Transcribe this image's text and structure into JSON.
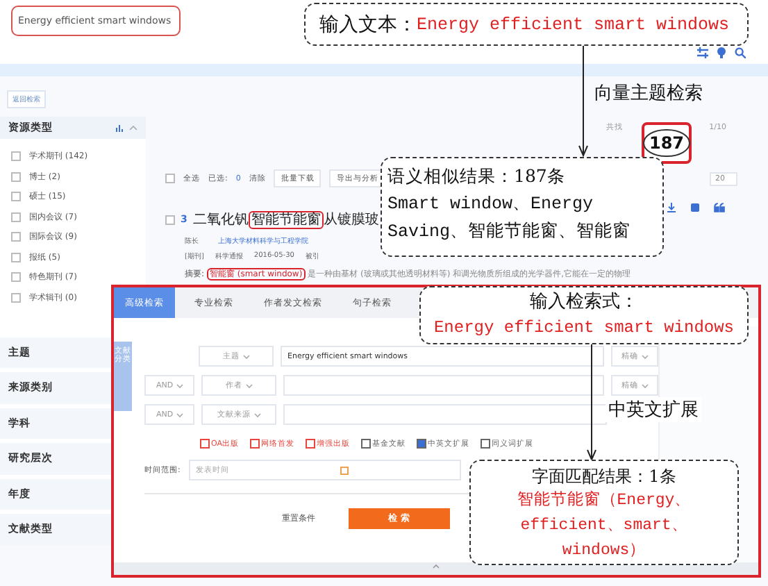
{
  "search_box": {
    "value": "Energy efficient smart windows"
  },
  "back_button": "返回检索",
  "sidebar": {
    "title": "资源类型",
    "items": [
      {
        "label": "学术期刊 (142)",
        "checked": false
      },
      {
        "label": "博士 (2)",
        "checked": false
      },
      {
        "label": "硕士 (15)",
        "checked": false
      },
      {
        "label": "国内会议 (7)",
        "checked": false
      },
      {
        "label": "国际会议 (9)",
        "checked": false
      },
      {
        "label": "报纸 (5)",
        "checked": false
      },
      {
        "label": "特色期刊 (7)",
        "checked": false
      },
      {
        "label": "学术辑刊 (0)",
        "checked": false
      }
    ],
    "sections": [
      "主题",
      "来源类别",
      "学科",
      "研究层次",
      "年度",
      "文献类型"
    ]
  },
  "summary": {
    "prefix": "共找",
    "page": "1/10"
  },
  "toolbar": {
    "select_all_checked": false,
    "select_all": "全选",
    "selected_label": "已选:",
    "selected_count": "0",
    "clear": "清除",
    "buttons": [
      "批量下载",
      "导出与分析"
    ],
    "page_size": "20"
  },
  "result": {
    "checked": false,
    "index": "3",
    "title_before": "二氧化钒",
    "title_highlight": "智能节能窗",
    "title_after": "从镀膜玻",
    "author": "陈长",
    "affiliation": "上海大学材料科学与工程学院",
    "meta": [
      "[期刊]",
      "科学通报",
      "2016-05-30",
      "被引"
    ],
    "abstract_label": "摘要:",
    "abstract_highlight": "智能窗 (smart window)",
    "abstract_rest": "是一种由基材 (玻璃或其他透明材料等) 和调光物质所组成的光学器件,它能在一定的物理"
  },
  "advanced": {
    "tabs": [
      {
        "label": "高级检索",
        "selected": true
      },
      {
        "label": "专业检索",
        "selected": false
      },
      {
        "label": "作者发文检索",
        "selected": false
      },
      {
        "label": "句子检索",
        "selected": false
      }
    ],
    "side_tab": "文献分类",
    "rows": [
      {
        "field": "主题",
        "value": "Energy efficient smart windows",
        "match": "精确"
      },
      {
        "logic": "AND",
        "field": "作者",
        "match": "精确"
      },
      {
        "logic": "AND",
        "field": "文献来源"
      }
    ],
    "options": [
      {
        "label": "OA出版",
        "checked": false,
        "color": "#e8453c"
      },
      {
        "label": "网络首发",
        "checked": false,
        "color": "#e8453c"
      },
      {
        "label": "增强出版",
        "checked": false,
        "color": "#e8453c"
      },
      {
        "label": "基金文献",
        "checked": false,
        "color": "#666666"
      },
      {
        "label": "中英文扩展",
        "checked": true,
        "color": "#666666"
      },
      {
        "label": "同义词扩展",
        "checked": false,
        "color": "#666666"
      }
    ],
    "time_label": "时间范围:",
    "time_placeholder": "发表时间",
    "reset": "重置条件",
    "search": "检 索"
  },
  "annotations": {
    "input_text": {
      "label": "输入文本：",
      "query": "Energy efficient smart windows"
    },
    "vector_label": "向量主题检索",
    "total": "187",
    "semantic": {
      "title": "语义相似结果：187条",
      "lines": [
        "Smart window、Energy",
        "Saving、智能节能窗、智能窗"
      ]
    },
    "query_input": {
      "label": "输入检索式：",
      "query": "Energy efficient smart windows"
    },
    "expansion_label": "中英文扩展",
    "literal": {
      "title": "字面匹配结果：1条",
      "detail": "智能节能窗（Energy、efficient、smart、windows）"
    }
  }
}
